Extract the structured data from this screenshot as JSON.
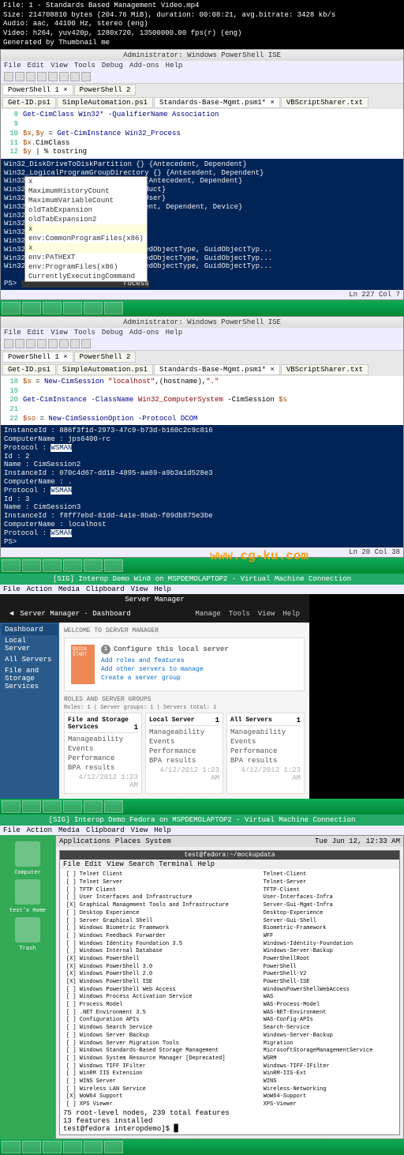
{
  "meta": {
    "file": "File: 1 - Standards Based Management Video.mp4",
    "size": "Size: 214708810 bytes (204.76 MiB), duration: 00:08:21, avg.bitrate: 3428 kb/s",
    "audio": "Audio: aac, 44100 Hz, stereo (eng)",
    "video": "Video: h264, yuv420p, 1280x720, 13500000.00 fps(r) (eng)",
    "gen": "Generated by Thumbnail me"
  },
  "ise": {
    "title": "Administrator: Windows PowerShell ISE",
    "menu": [
      "File",
      "Edit",
      "View",
      "Tools",
      "Debug",
      "Add-ons",
      "Help"
    ],
    "tabrow": {
      "ps1": "PowerShell 1 ×",
      "ps2": "PowerShell 2"
    },
    "tabs": [
      "Get-ID.ps1",
      "SimpleAutomation.ps1",
      "Standards-Base-Mgmt.psm1* ×",
      "VBScriptSharer.txt"
    ],
    "script1": {
      "l8": {
        "n": "8",
        "t": "Get-CimClass Win32* -QualifierName Association"
      },
      "l10": {
        "n": "10",
        "v": "$x,$y",
        "eq": " = ",
        "t": "Get-CimInstance Win32_Process"
      },
      "l11": {
        "n": "11",
        "v": "$x.",
        "t": "CimClass"
      },
      "l12": {
        "n": "12",
        "v": "$y",
        "t": " | % tostring"
      }
    },
    "console1": [
      "Win32_DiskDriveToDiskPartition          {}                   {Antecedent, Dependent}",
      "Win32_LogicalProgramGroupDirectory      {}                   {Antecedent, Dependent}",
      "Win32_ShadowDiffVolumeSupport           {}                   {Antecedent, Dependent}",
      "Win32_ProductCheck                      {}                   {Check, Product}",
      "Win32_NTLogEventUser                    {}                   {Record, User}",
      "Win32_ProtocolBinding                   {}                   {Antecedent, Dependent, Device}",
      "Win32                                   {}                   {Collection, Setting}",
      "Win32                                   {}                   {Collection, Setting}",
      "Win32                                   {}                   {Computer, Record}",
      "Win32                                   {}                   {Check, Location}",
      "Win32                                   {}                   {AccessMask, GuidInheritedObjectType, GuidObjectTyp...",
      "Win32                                   {}                   {AccessMask, GuidInheritedObjectType, GuidObjectTyp...",
      "Win32                                   {}                   {AccessMask, GuidInheritedObjectType, GuidObjectTyp..."
    ],
    "intellisense": [
      "x",
      "MaximumHistoryCount",
      "MaximumVariableCount",
      "oldTabExpansion",
      "oldTabExpansion2",
      "x",
      "env:CommonProgramFiles(x86)",
      "x",
      "env:PATHEXT",
      "env:ProgramFiles(x86)",
      "CurrentlyExecutingCommand"
    ],
    "prompt1": "PS>",
    "promptcmd": "rocess",
    "status1": {
      "left": "",
      "right": "Ln 227  Col 7"
    },
    "tabs2": [
      "Get-ID.ps1",
      "SimpleAutomation.ps1",
      "Standards-Base-Mgmt.psm1* ×",
      "VBScriptSharer.txt"
    ],
    "script2": {
      "l18": {
        "n": "18",
        "v": "$s",
        "eq": " = ",
        "c": "New-CimSession ",
        "s": "\"localhost\"",
        ",(hostname),": ",\".\""
      },
      "l20": {
        "n": "20",
        "c": "Get-CimInstance -ClassName ",
        "s": "Win32_ComputerSystem",
        " -CimSession ": " -CimSession ",
        "v": "$s"
      },
      "l22": {
        "n": "22",
        "v": "$so",
        "eq": " = ",
        "c": "New-CimSessionOption -Protocol ",
        "k": "DCOM"
      }
    },
    "console2": [
      "InstanceId   : 886f3f1d-2973-47c9-b73d-b160c2c9c816",
      "ComputerName : jps6400-rc",
      "Protocol     : WSMAN",
      "",
      "Id           : 2",
      "Name         : CimSession2",
      "InstanceId   : 070c4d67-dd18-4895-aa69-a9b3a1d528e3",
      "ComputerName : .",
      "Protocol     : WSMAN",
      "",
      "Id           : 3",
      "Name         : CimSession3",
      "InstanceId   : f8ff7ebd-81dd-4a1e-8bab-f09db875e3be",
      "ComputerName : localhost",
      "Protocol     : WSMAN",
      "",
      "",
      "PS>"
    ],
    "status2": {
      "right": "Ln 20  Col 38"
    }
  },
  "watermark": "www.cg-ku.com",
  "vm1": {
    "title": "[SIG] Interop Demo Win8 on MSPDEMOLAPTOP2 - Virtual Machine Connection",
    "menu": [
      "File",
      "Action",
      "Media",
      "Clipboard",
      "View",
      "Help"
    ]
  },
  "sm": {
    "title": "Server Manager",
    "head": "Server Manager · Dashboard",
    "headmenu": [
      "Manage",
      "Tools",
      "View",
      "Help"
    ],
    "side": [
      "Dashboard",
      "Local Server",
      "All Servers",
      "File and Storage Services"
    ],
    "welcome": "WELCOME TO SERVER MANAGER",
    "quick": "QUICK START",
    "config": "Configure this local server",
    "links": [
      "Add roles and features",
      "Add other servers to manage",
      "Create a server group"
    ],
    "roles": "ROLES AND SERVER GROUPS",
    "rolesub": "Roles: 1  |  Server groups: 1  |  Servers total: 1",
    "tiles": [
      {
        "t": "File and Storage Services",
        "n": "1",
        "items": [
          "Manageability",
          "Events",
          "Performance",
          "BPA results"
        ]
      },
      {
        "t": "Local Server",
        "n": "1",
        "items": [
          "Manageability",
          "Events",
          "Performance",
          "BPA results"
        ]
      },
      {
        "t": "All Servers",
        "n": "1",
        "items": [
          "Manageability",
          "Events",
          "Performance",
          "BPA results"
        ]
      }
    ],
    "tiletime": "4/12/2012 1:23 AM"
  },
  "vm2": {
    "title": "[SIG] Interop Demo Fedora on MSPDEMOLAPTOP2 - Virtual Machine Connection",
    "menu": [
      "File",
      "Action",
      "Media",
      "Clipboard",
      "View",
      "Help"
    ]
  },
  "fedora": {
    "top": [
      "Applications",
      "Places",
      "System"
    ],
    "time": "Tue Jun 12, 12:33 AM",
    "desk": [
      {
        "l": "Computer"
      },
      {
        "l": "test's Home"
      },
      {
        "l": "Trash"
      }
    ],
    "term": {
      "title": "test@fedora:~/mockupdata",
      "menu": [
        "File",
        "Edit",
        "View",
        "Search",
        "Terminal",
        "Help"
      ],
      "rows": [
        [
          "[ ] Telnet Client",
          "Telnet-Client"
        ],
        [
          "[ ] Telnet Server",
          "Telnet-Server"
        ],
        [
          "[ ] TFTP Client",
          "TFTP-Client"
        ],
        [
          "[ ] User Interfaces and Infrastructure",
          "User-Interfaces-Infra"
        ],
        [
          "    [X] Graphical Management Tools and Infrastructure",
          "Server-Gui-Mgmt-Infra"
        ],
        [
          "    [ ] Desktop Experience",
          "Desktop-Experience"
        ],
        [
          "    [ ] Server Graphical Shell",
          "Server-Gui-Shell"
        ],
        [
          "[ ] Windows Biometric Framework",
          "Biometric-Framework"
        ],
        [
          "[ ] Windows Feedback Forwarder",
          "WFF"
        ],
        [
          "[ ] Windows Identity Foundation 3.5",
          "Windows-Identity-Foundation"
        ],
        [
          "[ ] Windows Internal Database",
          "Windows-Server-Backup"
        ],
        [
          "[X] Windows PowerShell",
          "PowerShellRoot"
        ],
        [
          "    [X] Windows PowerShell 3.0",
          "PowerShell"
        ],
        [
          "    [X] Windows PowerShell 2.0",
          "PowerShell-V2"
        ],
        [
          "    [X] Windows PowerShell ISE",
          "PowerShell-ISE"
        ],
        [
          "    [ ] Windows PowerShell Web Access",
          "WindowsPowerShellWebAccess"
        ],
        [
          "[ ] Windows Process Activation Service",
          "WAS"
        ],
        [
          "    [ ] Process Model",
          "WAS-Process-Model"
        ],
        [
          "    [ ] .NET Environment 3.5",
          "WAS-NET-Environment"
        ],
        [
          "    [ ] Configuration APIs",
          "WAS-Config-APIs"
        ],
        [
          "[ ] Windows Search Service",
          "Search-Service"
        ],
        [
          "[ ] Windows Server Backup",
          "Windows-Server-Backup"
        ],
        [
          "[ ] Windows Server Migration Tools",
          "Migration"
        ],
        [
          "[ ] Windows Standards-Based Storage Management",
          "MicrosoftStorageManagementService"
        ],
        [
          "[ ] Windows System Resource Manager [Deprecated]",
          "WSRM"
        ],
        [
          "[ ] Windows TIFF IFilter",
          "Windows-TIFF-IFilter"
        ],
        [
          "[ ] WinRM IIS Extension",
          "WinRM-IIS-Ext"
        ],
        [
          "[ ] WINS Server",
          "WINS"
        ],
        [
          "[ ] Wireless LAN Service",
          "Wireless-Networking"
        ],
        [
          "[X] WoW64 Support",
          "WoW64-Support"
        ],
        [
          "[ ] XPS Viewer",
          "XPS-Viewer"
        ]
      ],
      "foot1": "75 root-level nodes, 239 total features",
      "foot2": "13 features installed",
      "prompt": "test@fedora interopdemo]$ "
    }
  }
}
